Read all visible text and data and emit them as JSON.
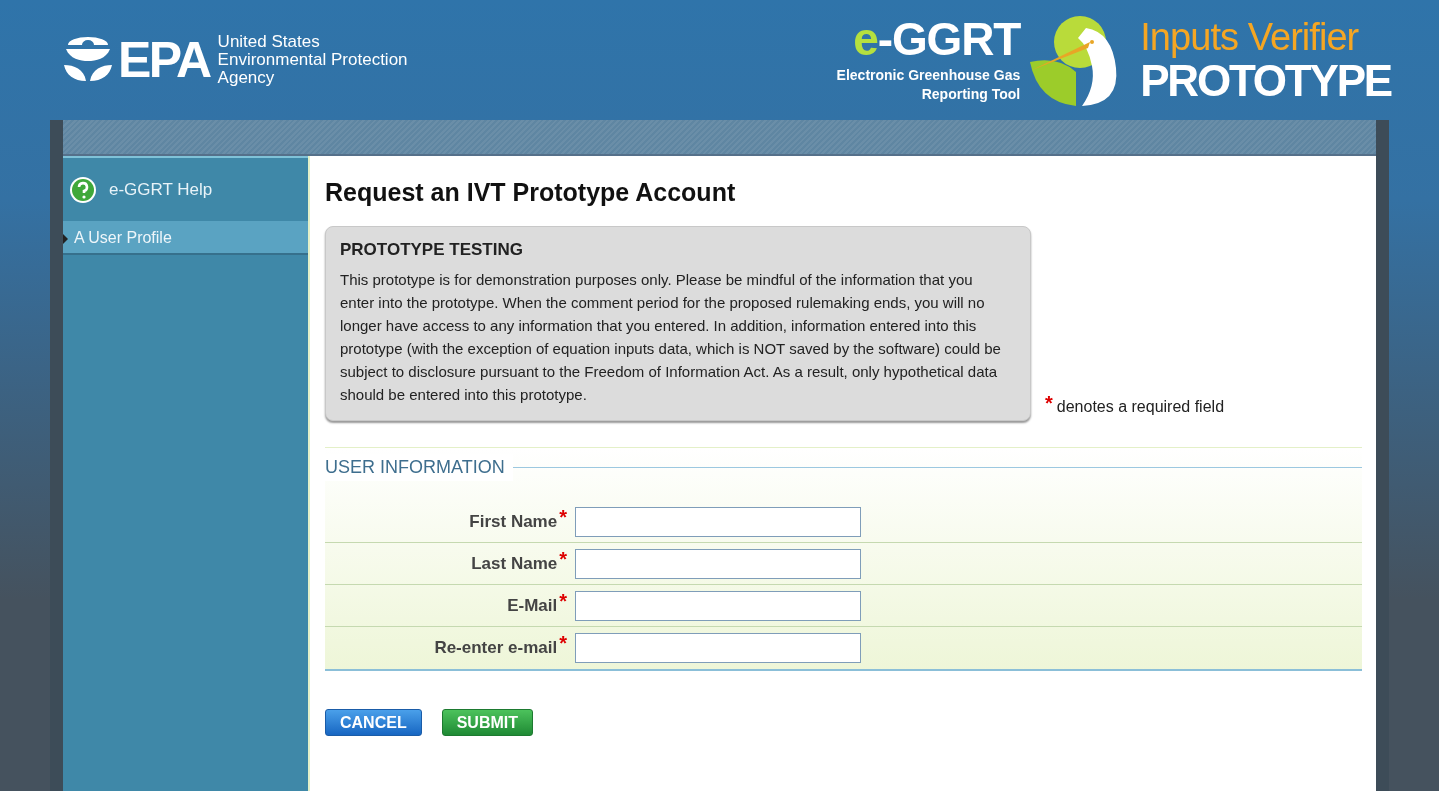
{
  "header": {
    "agency_logo": "EPA",
    "agency_name": [
      "United States",
      "Environmental Protection",
      "Agency"
    ],
    "product_logo": {
      "prefix": "e",
      "name": "-GGRT",
      "tagline": [
        "Electronic Greenhouse Gas",
        "Reporting Tool"
      ]
    },
    "product_title": "Inputs Verifier",
    "product_badge": "PROTOTYPE"
  },
  "sidebar": {
    "help_link": "e-GGRT Help",
    "items": [
      {
        "label": "A User Profile",
        "selected": true
      }
    ]
  },
  "page_title": "Request an IVT Prototype Account",
  "notice": {
    "title": "PROTOTYPE TESTING",
    "text": "This prototype is for demonstration purposes only. Please be mindful of the information that you enter into the prototype. When the comment period for the proposed rulemaking ends, you will no longer have access to any information that you entered. In addition, information entered into this prototype (with the exception of equation inputs data, which is NOT saved by the software) could be subject to disclosure pursuant to the Freedom of Information Act. As a result, only hypothetical data should be entered into this prototype."
  },
  "required_note": {
    "mark": "*",
    "text": "denotes a required field"
  },
  "user_information": {
    "legend": "USER INFORMATION",
    "fields": [
      {
        "label": "First Name",
        "required_mark": "*"
      },
      {
        "label": "Last Name",
        "required_mark": "*"
      },
      {
        "label": "E-Mail",
        "required_mark": "*"
      },
      {
        "label": "Re-enter e-mail",
        "required_mark": "*"
      }
    ]
  },
  "buttons": [
    {
      "label": "CANCEL",
      "kind": "cancel"
    },
    {
      "label": "SUBMIT",
      "kind": "submit"
    }
  ]
}
